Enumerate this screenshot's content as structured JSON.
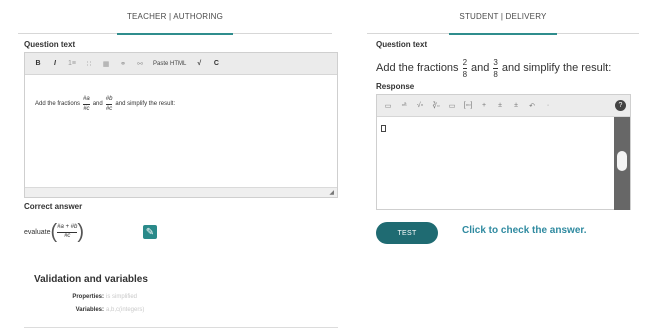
{
  "tabs": {
    "authoring": "TEACHER | AUTHORING",
    "delivery": "STUDENT | DELIVERY"
  },
  "authoring": {
    "question_label": "Question text",
    "toolbar": {
      "bold": "B",
      "italic": "I",
      "ordered_list": "1≡",
      "bullet_list": "∷",
      "table": "▦",
      "link": "⚭",
      "unlink": "⚯",
      "paste_html": "Paste HTML",
      "formula": "√",
      "clear": "C"
    },
    "body": {
      "prefix": "Add the fractions",
      "frac1_num": "#a",
      "frac1_den": "#c",
      "and": "and",
      "frac2_num": "#b",
      "frac2_den": "#c",
      "suffix": "and simplify the result:"
    },
    "correct_answer_label": "Correct answer",
    "answer": {
      "fn": "evaluate",
      "num": "#a + #b",
      "den": "#c"
    }
  },
  "validation": {
    "title": "Validation and variables",
    "properties_label": "Properties:",
    "properties_value": "is simplified",
    "variables_label": "Variables:",
    "variables_value": "a,b,c(integers)"
  },
  "delivery": {
    "question_label": "Question text",
    "question": {
      "prefix": "Add the fractions",
      "frac1_num": "2",
      "frac1_den": "8",
      "and": "and",
      "frac2_num": "3",
      "frac2_den": "8",
      "suffix": "and simplify the result:"
    },
    "response_label": "Response",
    "toolbar": [
      "▭",
      "▫ᵃ",
      "√▫",
      "∛▫",
      "▭",
      "[▫▫]",
      "+",
      "±",
      "±",
      "↶",
      "·"
    ],
    "help": "?",
    "test_button": "TEST",
    "test_hint": "Click to check the answer."
  },
  "colors": {
    "accent": "#2a8a8a",
    "test_button": "#1f6b72",
    "hint": "#2f8aa0"
  }
}
